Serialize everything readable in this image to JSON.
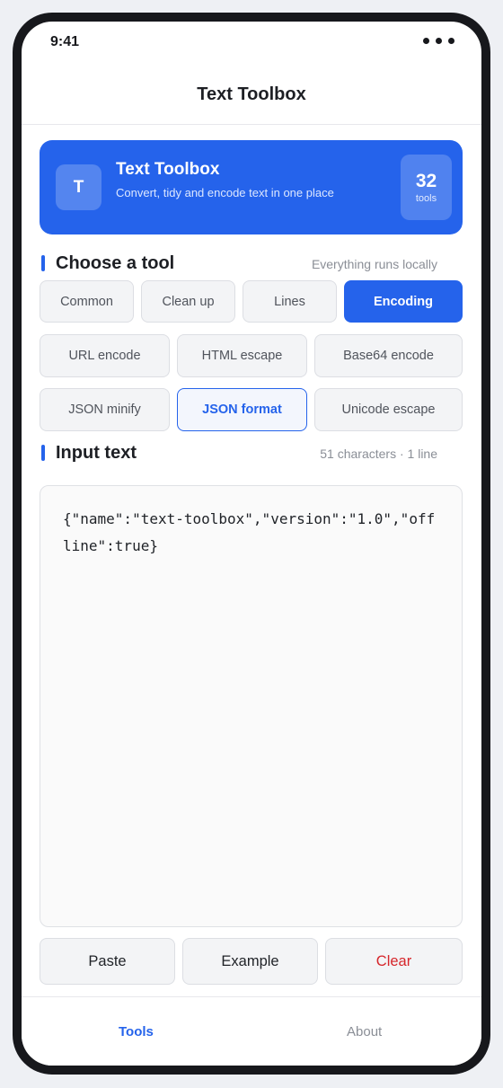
{
  "status": {
    "time": "9:41"
  },
  "nav": {
    "title": "Text Toolbox"
  },
  "hero": {
    "logo_letter": "T",
    "title": "Text Toolbox",
    "subtitle": "Convert, tidy and encode text in one place",
    "count": "32",
    "count_label": "tools"
  },
  "tools_section": {
    "title": "Choose a tool",
    "meta": "Everything runs locally",
    "categories": [
      "Common",
      "Clean up",
      "Lines",
      "Encoding"
    ],
    "active_category": "Encoding",
    "tools": [
      "URL encode",
      "HTML escape",
      "Base64 encode",
      "JSON minify",
      "JSON format",
      "Unicode escape"
    ],
    "selected_tool": "JSON format"
  },
  "input_section": {
    "title": "Input text",
    "meta": "51 characters · 1 line",
    "value": "{\"name\":\"text-toolbox\",\"version\":\"1.0\",\"offline\":true}"
  },
  "actions": {
    "paste": "Paste",
    "example": "Example",
    "clear": "Clear"
  },
  "tabs": {
    "tools": "Tools",
    "about": "About",
    "active": "Tools"
  },
  "colors": {
    "accent": "#2563eb",
    "danger": "#d6262b"
  }
}
